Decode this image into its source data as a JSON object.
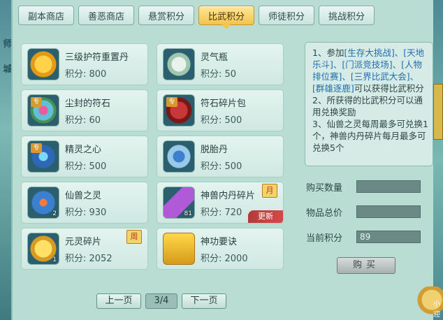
{
  "left_edge": {
    "chars": [
      "师",
      "城"
    ]
  },
  "right_edge": {
    "mascot_text": "小迎"
  },
  "tabs": [
    {
      "label": "副本商店",
      "active": false
    },
    {
      "label": "善恶商店",
      "active": false
    },
    {
      "label": "悬赏积分",
      "active": false
    },
    {
      "label": "比武积分",
      "active": true
    },
    {
      "label": "师徒积分",
      "active": false
    },
    {
      "label": "挑战积分",
      "active": false
    }
  ],
  "items": [
    {
      "name": "三级护符重置丹",
      "points": "积分: 800",
      "icon": "amulet-pill-icon",
      "zhuan": "",
      "count": "",
      "badge": "",
      "new": ""
    },
    {
      "name": "灵气瓶",
      "points": "积分: 50",
      "icon": "spirit-vase-icon",
      "zhuan": "",
      "count": "",
      "badge": "",
      "new": ""
    },
    {
      "name": "尘封的符石",
      "points": "积分: 60",
      "icon": "rune-stone-icon",
      "zhuan": "专",
      "count": "",
      "badge": "",
      "new": ""
    },
    {
      "name": "符石碎片包",
      "points": "积分: 500",
      "icon": "rune-shard-bag-icon",
      "zhuan": "专",
      "count": "",
      "badge": "",
      "new": ""
    },
    {
      "name": "精灵之心",
      "points": "积分: 500",
      "icon": "elf-heart-icon",
      "zhuan": "专",
      "count": "",
      "badge": "",
      "new": ""
    },
    {
      "name": "脱胎丹",
      "points": "积分: 500",
      "icon": "rebirth-pill-icon",
      "zhuan": "",
      "count": "",
      "badge": "",
      "new": ""
    },
    {
      "name": "仙兽之灵",
      "points": "积分: 930",
      "icon": "beast-spirit-icon",
      "zhuan": "",
      "count": "2",
      "badge": "",
      "new": ""
    },
    {
      "name": "神兽内丹碎片",
      "points": "积分: 720",
      "icon": "beast-core-shard-icon",
      "zhuan": "",
      "count": "81",
      "badge": "月",
      "new": "更新"
    },
    {
      "name": "元灵碎片",
      "points": "积分: 2052",
      "icon": "spirit-shard-icon",
      "zhuan": "",
      "count": "1",
      "badge": "周",
      "new": ""
    },
    {
      "name": "神功要诀",
      "points": "积分: 2000",
      "icon": "skill-book-icon",
      "zhuan": "",
      "count": "",
      "badge": "",
      "new": ""
    }
  ],
  "pager": {
    "prev": "上一页",
    "page": "3/4",
    "next": "下一页"
  },
  "info": {
    "p1a": "1、参加",
    "p1b": "[生存大挑战]、[天地乐斗]、[门派竞技场]、[人物排位赛]、[三界比武大会]、[群雄逐鹿]",
    "p1c": "可以获得比武积分",
    "p2": "2、所获得的比武积分可以通用兑换奖励",
    "p3": "3、仙兽之灵每周最多可兑换1个，神兽内丹碎片每月最多可兑换5个"
  },
  "form": {
    "qty_label": "购买数量",
    "qty_value": "",
    "total_label": "物品总价",
    "total_value": "",
    "current_label": "当前积分",
    "current_value": "89",
    "buy_label": "购买"
  }
}
